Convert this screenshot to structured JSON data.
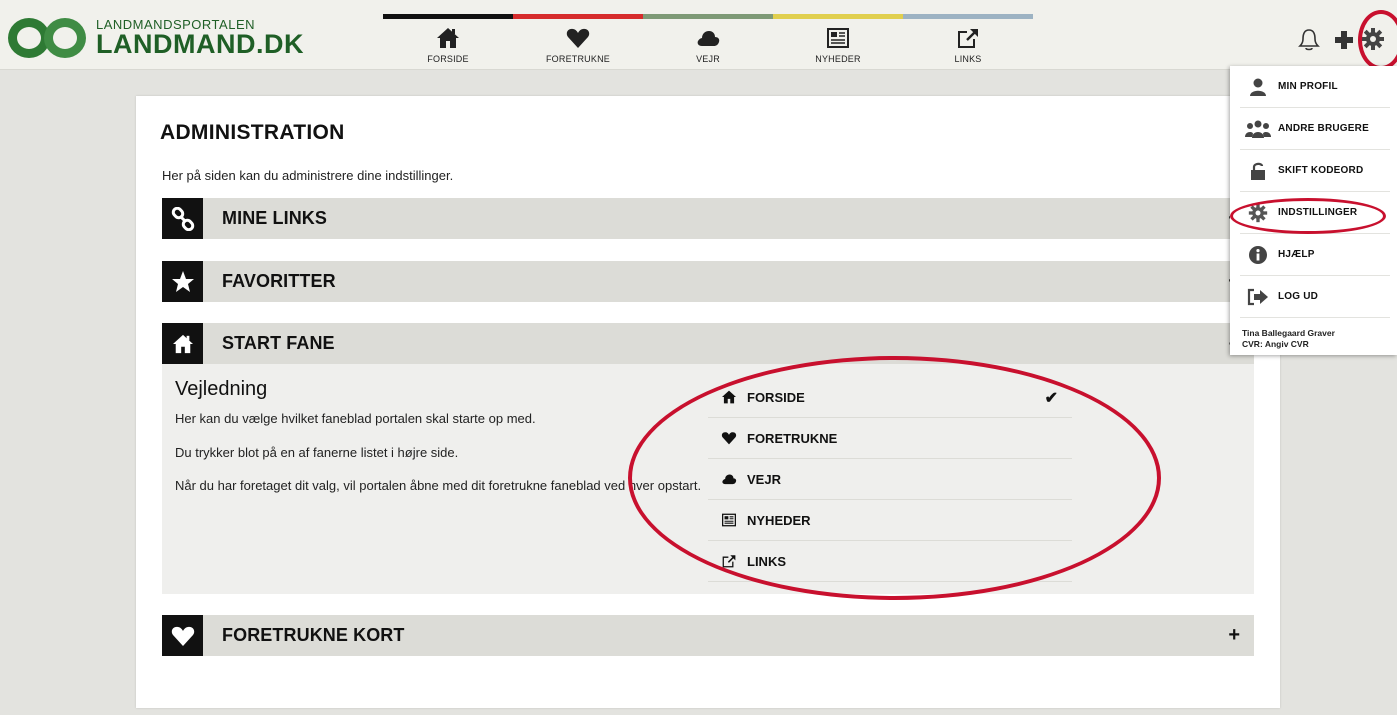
{
  "logo": {
    "small": "LANDMANDSPORTALEN",
    "big": "LANDMAND.DK"
  },
  "nav": [
    {
      "label": "FORSIDE",
      "icon": "home-icon",
      "strip": "#111111"
    },
    {
      "label": "FORETRUKNE",
      "icon": "heart-icon",
      "strip": "#d62c2c"
    },
    {
      "label": "VEJR",
      "icon": "cloud-icon",
      "strip": "#7e9a76"
    },
    {
      "label": "NYHEDER",
      "icon": "newspaper-icon",
      "strip": "#e0cf4e"
    },
    {
      "label": "LINKS",
      "icon": "external-link-icon",
      "strip": "#9db3c3"
    }
  ],
  "page": {
    "title": "ADMINISTRATION",
    "subtitle": "Her på siden kan du administrere dine indstillinger."
  },
  "sections": [
    {
      "title": "MINE LINKS",
      "icon": "chain-link-icon",
      "toggle": "+"
    },
    {
      "title": "FAVORITTER",
      "icon": "star-icon",
      "toggle": "+"
    },
    {
      "title": "START FANE",
      "icon": "home-icon",
      "toggle": "–"
    },
    {
      "title": "FORETRUKNE KORT",
      "icon": "heart-icon",
      "toggle": "+"
    }
  ],
  "guide": {
    "title": "Vejledning",
    "p1": "Her kan du vælge hvilket faneblad portalen skal starte op med.",
    "p2": "Du trykker blot på en af fanerne listet i højre side.",
    "p3": "Når du har foretaget dit valg, vil portalen åbne med dit foretrukne faneblad ved hver opstart."
  },
  "start_options": [
    {
      "label": "FORSIDE",
      "icon": "home-icon",
      "selected": true,
      "check": "✔"
    },
    {
      "label": "FORETRUKNE",
      "icon": "heart-icon",
      "selected": false
    },
    {
      "label": "VEJR",
      "icon": "cloud-icon",
      "selected": false
    },
    {
      "label": "NYHEDER",
      "icon": "newspaper-icon",
      "selected": false
    },
    {
      "label": "LINKS",
      "icon": "external-link-icon",
      "selected": false
    }
  ],
  "menu": {
    "items": [
      {
        "label": "MIN PROFIL",
        "icon": "user-icon"
      },
      {
        "label": "ANDRE BRUGERE",
        "icon": "users-icon"
      },
      {
        "label": "SKIFT KODEORD",
        "icon": "unlock-icon"
      },
      {
        "label": "INDSTILLINGER",
        "icon": "gear-icon"
      },
      {
        "label": "HJÆLP",
        "icon": "info-icon"
      },
      {
        "label": "LOG UD",
        "icon": "sign-out-icon"
      }
    ],
    "user_name": "Tina Ballegaard Graver",
    "user_cvr": "CVR: Angiv CVR"
  },
  "colors": {
    "annotation": "#c8102e",
    "brand_green": "#2e7a34"
  }
}
